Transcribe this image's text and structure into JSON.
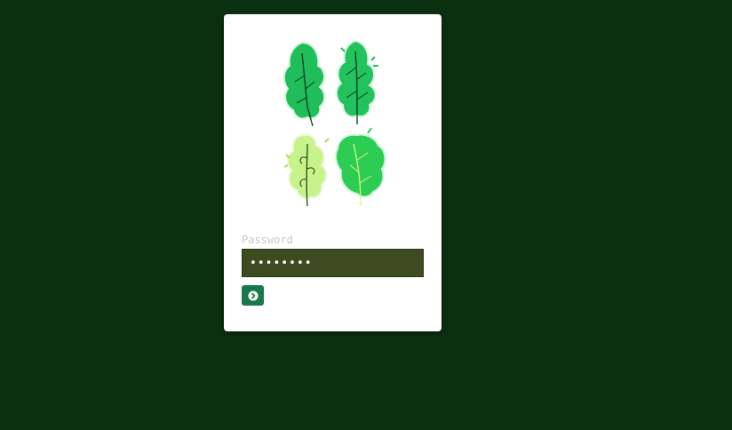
{
  "login": {
    "password_label": "Password",
    "password_value": "12345678",
    "submit_icon": "chevron-right-circle-icon",
    "logo_icon": "four-leaves-logo"
  },
  "colors": {
    "background": "#0b3010",
    "card": "#ffffff",
    "input_background": "#3e4a20",
    "button": "#17794a",
    "label": "#c9c9c9"
  }
}
